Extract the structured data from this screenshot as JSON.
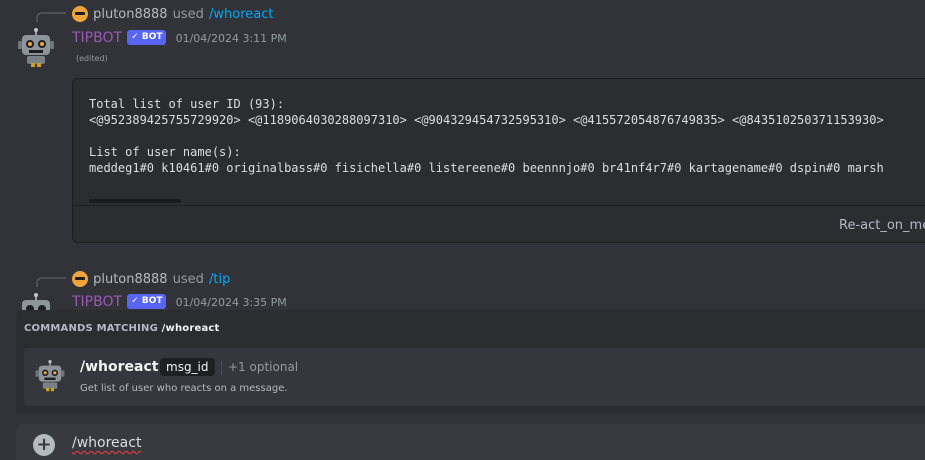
{
  "message1": {
    "reply": {
      "user": "pluton8888",
      "used": "used",
      "command": "/whoreact"
    },
    "author": "TIPBOT",
    "badge": "✓ BOT",
    "timestamp": "01/04/2024 3:11 PM",
    "edited": "(edited)",
    "code_lines": [
      "Total list of user ID (93):",
      "<@952389425755729920> <@1189064030288097310> <@904329454732595310> <@415572054876749835> <@843510250371153930>",
      "",
      "List of user name(s):",
      "meddeg1#0 k10461#0 originalbass#0 fisichella#0 listereene#0 beennnjo#0 br41nf4r7#0 kartagename#0 dspin#0 marsh"
    ],
    "button": "Re-act_on_me"
  },
  "message2": {
    "reply": {
      "user": "pluton8888",
      "used": "used",
      "command": "/tip"
    },
    "author": "TIPBOT",
    "badge": "✓ BOT",
    "timestamp": "01/04/2024 3:35 PM"
  },
  "autocomplete": {
    "header_prefix": "COMMANDS MATCHING",
    "header_query": "/whoreact",
    "command": "/whoreact",
    "param": "msg_id",
    "optional": "+1 optional",
    "description": "Get list of user who reacts on a message."
  },
  "input": {
    "value": "/whoreact"
  },
  "icons": {
    "reply_avatar": "sunglasses-face-icon",
    "bot_avatar": "robot-icon",
    "plus": "plus-circle-icon"
  },
  "colors": {
    "background": "#313338",
    "bot_name": "#9b59b6",
    "badge": "#5865f2",
    "command_link": "#00a8fc"
  }
}
